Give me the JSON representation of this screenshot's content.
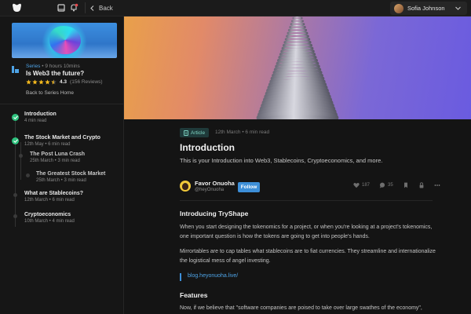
{
  "topbar": {
    "back_label": "Back",
    "user_name": "Sofia Johnson"
  },
  "sidebar": {
    "series_label": "Series",
    "series_meta": "• 9 hours 10mins",
    "series_title": "Is Web3 the future?",
    "rating": "4.3",
    "reviews": "(156 Reviews)",
    "stars_filled": 4.3,
    "back_to_series": "Back to Series Home",
    "toc": [
      {
        "title": "Introduction",
        "sub": "4 min read"
      },
      {
        "title": "The Stock Market and Crypto",
        "sub": "12th May • 6 min read"
      },
      {
        "title": "The Post Luna Crash",
        "sub": "25th March • 3 min read"
      },
      {
        "title": "The Greatest Stock Market",
        "sub": "25th March • 3 min read"
      },
      {
        "title": "What are Stablecoins?",
        "sub": "12th March • 6 min read"
      },
      {
        "title": "Cryptoeconomics",
        "sub": "10th March • 4 min read"
      }
    ]
  },
  "article": {
    "tag": "Article",
    "meta": "12th March  •  6 min read",
    "title": "Introduction",
    "subtitle": "This is your Introduction into Web3, Stablecoins, Cryptoeconomics, and more.",
    "author_name": "Favor Onuoha",
    "author_handle": "@heyOnuoha",
    "follow_label": "Follow",
    "likes": "187",
    "comments": "35",
    "h_introducing": "Introducing TryShape",
    "p1": "When you start designing the tokenomics for a project, or when you're looking at a project's tokenomics, one important question is how the tokens are going to get into people's hands.",
    "p2": "Mirrortables are to cap tables what stablecoins are to fiat currencies. They streamline and internationalize the logistical mess of angel investing.",
    "link": "blog.heyonuoha.live/",
    "h_features": "Features",
    "p3": "Now, if we believe that \"software companies are poised to take over large swathes of the economy\","
  },
  "colors": {
    "accent_blue": "#3d8fd8",
    "success_green": "#2ec27e"
  }
}
